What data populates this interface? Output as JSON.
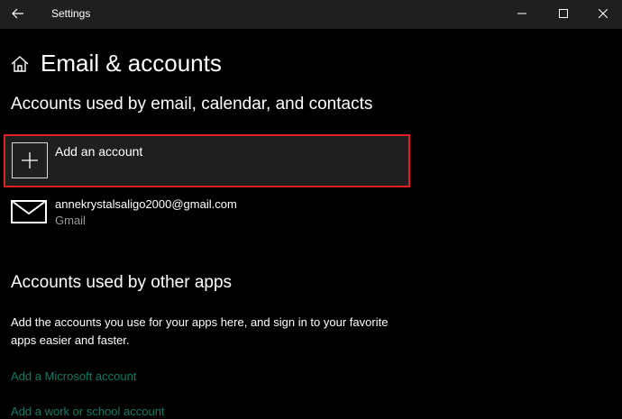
{
  "window": {
    "title": "Settings",
    "back_icon": "arrow-left-icon",
    "controls": [
      "minimize-icon",
      "maximize-icon",
      "close-icon"
    ]
  },
  "header": {
    "icon": "home-icon",
    "title": "Email & accounts"
  },
  "email_section": {
    "heading": "Accounts used by email, calendar, and contacts",
    "add_account": {
      "icon": "plus-icon",
      "label": "Add an account",
      "highlight_color": "#e31e24"
    },
    "accounts": [
      {
        "icon": "mail-icon",
        "email": "annekrystalsaligo2000@gmail.com",
        "provider": "Gmail"
      }
    ]
  },
  "other_apps_section": {
    "heading": "Accounts used by other apps",
    "description": "Add the accounts you use for your apps here, and sign in to your favorite apps easier and faster.",
    "links": [
      "Add a Microsoft account",
      "Add a work or school account"
    ]
  },
  "colors": {
    "background": "#000000",
    "title_bar": "#1f1f1f",
    "link": "#0f7a66",
    "secondary_text": "#9a9a9a"
  }
}
